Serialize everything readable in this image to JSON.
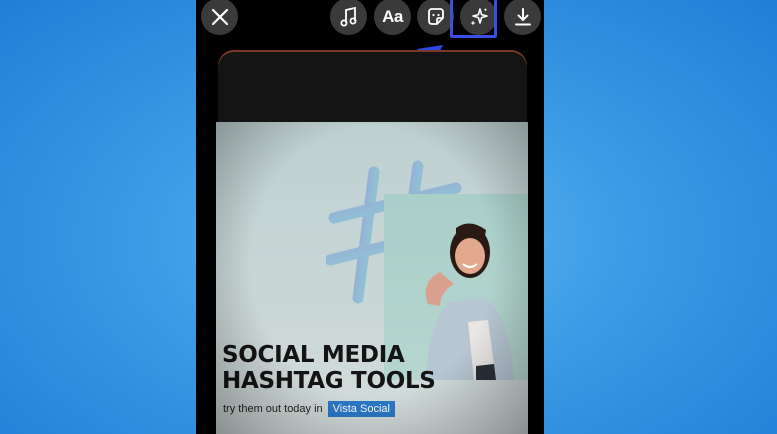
{
  "toolbar": {
    "close_icon": "close-icon",
    "music_icon": "music-note-icon",
    "text_label": "Aa",
    "sticker_icon": "sticker-icon",
    "effects_icon": "sparkles-icon",
    "download_icon": "download-icon"
  },
  "story": {
    "headline_line1": "SOCIAL MEDIA",
    "headline_line2": "HASHTAG TOOLS",
    "subline": "try them out today in",
    "brand": "Vista Social"
  },
  "colors": {
    "background": "#3a9be6",
    "highlight": "#3a4fe6",
    "arrow": "#2f49e0",
    "brand_tag": "#2a78c8"
  }
}
